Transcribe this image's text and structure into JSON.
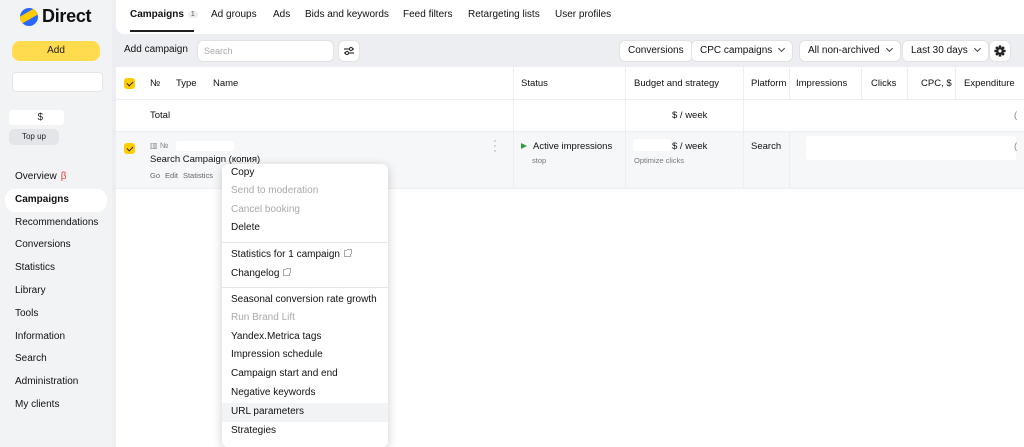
{
  "app": {
    "logo_text": "Direct",
    "logo_icon": "yandex-direct-logo"
  },
  "sidebar": {
    "add_label": "Add",
    "balance_currency": "$",
    "topup_label": "Top up",
    "nav": [
      {
        "label": "Overview",
        "badge": "β"
      },
      {
        "label": "Campaigns",
        "active": true
      },
      {
        "label": "Recommendations"
      },
      {
        "label": "Conversions"
      },
      {
        "label": "Statistics"
      },
      {
        "label": "Library"
      },
      {
        "label": "Tools"
      },
      {
        "label": "Information"
      },
      {
        "label": "Search"
      },
      {
        "label": "Administration"
      },
      {
        "label": "My clients"
      }
    ]
  },
  "tabs": [
    {
      "label": "Campaigns",
      "count": "1",
      "active": true
    },
    {
      "label": "Ad groups"
    },
    {
      "label": "Ads"
    },
    {
      "label": "Bids and keywords"
    },
    {
      "label": "Feed filters"
    },
    {
      "label": "Retargeting lists"
    },
    {
      "label": "User profiles"
    }
  ],
  "toolbar": {
    "add_campaign": "Add campaign",
    "search_placeholder": "Search",
    "filter_icon": "sliders-icon",
    "conversions": "Conversions",
    "campaign_type": "CPC campaigns",
    "archive_filter": "All non-archived",
    "period": "Last 30 days",
    "settings_icon": "gear-icon"
  },
  "table": {
    "headers": {
      "number": "№",
      "type": "Type",
      "name": "Name",
      "status": "Status",
      "budget": "Budget and strategy",
      "platform": "Platform",
      "impressions": "Impressions",
      "clicks": "Clicks",
      "cpc": "CPC, $",
      "expenditure": "Expenditure"
    },
    "total": {
      "label": "Total",
      "budget": "$ / week",
      "trailing": "("
    },
    "campaign": {
      "type_icon": "bar-chart-icon",
      "number_prefix": "№",
      "name": "Search Campaign (копия)",
      "links": [
        "Go",
        "Edit",
        "Statistics"
      ],
      "status": "Active impressions",
      "status_action": "stop",
      "budget": "$ / week",
      "budget_action": "Optimize clicks",
      "platform": "Search",
      "trailing": "("
    }
  },
  "context_menu": {
    "groups": [
      [
        {
          "label": "Copy"
        },
        {
          "label": "Send to moderation",
          "disabled": true
        },
        {
          "label": "Cancel booking",
          "disabled": true
        },
        {
          "label": "Delete"
        }
      ],
      [
        {
          "label": "Statistics for 1 campaign",
          "external": true
        },
        {
          "label": "Changelog",
          "external": true
        }
      ],
      [
        {
          "label": "Seasonal conversion rate growth"
        },
        {
          "label": "Run Brand Lift",
          "disabled": true
        },
        {
          "label": "Yandex.Metrica tags"
        },
        {
          "label": "Impression schedule"
        },
        {
          "label": "Campaign start and end"
        },
        {
          "label": "Negative keywords"
        },
        {
          "label": "URL parameters",
          "hover": true
        },
        {
          "label": "Strategies"
        }
      ]
    ]
  }
}
